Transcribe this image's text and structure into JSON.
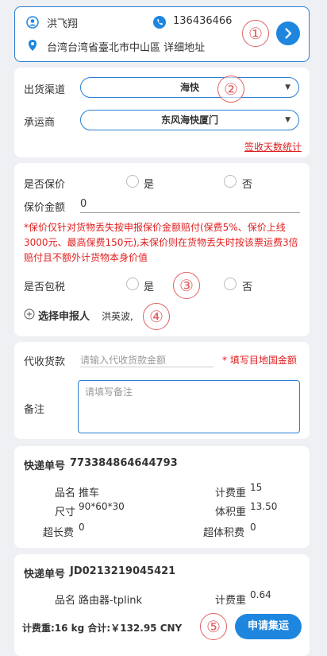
{
  "address": {
    "name": "洪飞翔",
    "phone": "136436466",
    "location": "台湾台湾省臺北市中山區 详细地址",
    "annotation": "①"
  },
  "shipping": {
    "channel_label": "出货渠道",
    "channel_value": "海快",
    "carrier_label": "承运商",
    "carrier_value": "东风海快厦门",
    "stats_link": "签收天数统计",
    "annotation": "②"
  },
  "insurance": {
    "insure_label": "是否保价",
    "yes": "是",
    "no": "否",
    "amount_label": "保价金额",
    "amount_value": "0",
    "notice": "*保价仅针对货物丢失按申报保价金额赔付(保费5%、保价上线3000元、最高保费150元),未保价则在货物丢失时按该票运费3倍赔付且不额外计货物本身价值",
    "tax_label": "是否包税",
    "tax_yes": "是",
    "tax_no": "否",
    "annotation_tax": "③",
    "declarant_label": "选择申报人",
    "declarant_value": "洪英波,",
    "annotation_declarant": "④"
  },
  "cod": {
    "label": "代收货款",
    "placeholder": "请输入代收货款金额",
    "hint": "* 填写目地国金额",
    "remark_label": "备注",
    "remark_placeholder": "请填写备注"
  },
  "packages": [
    {
      "tracking_label": "快递单号",
      "tracking_no": "773384864644793",
      "name_label": "品名",
      "name": "推车",
      "weight_label": "计费重",
      "weight": "15",
      "size_label": "尺寸",
      "size": "90*60*30",
      "vol_label": "体积重",
      "vol": "13.50",
      "over_len_label": "超长费",
      "over_len": "0",
      "over_vol_label": "超体积费",
      "over_vol": "0"
    },
    {
      "tracking_label": "快递单号",
      "tracking_no": "JD0213219045421",
      "name_label": "品名",
      "name": "路由器-tplink",
      "weight_label": "计费重",
      "weight": "0.64"
    }
  ],
  "footer": {
    "summary": "计费重:16 kg 合计:￥132.95 CNY",
    "annotation": "⑤",
    "apply": "申请集运"
  },
  "colors": {
    "accent": "#1f86df",
    "warning": "#e02020",
    "annotation": "#e06060"
  }
}
